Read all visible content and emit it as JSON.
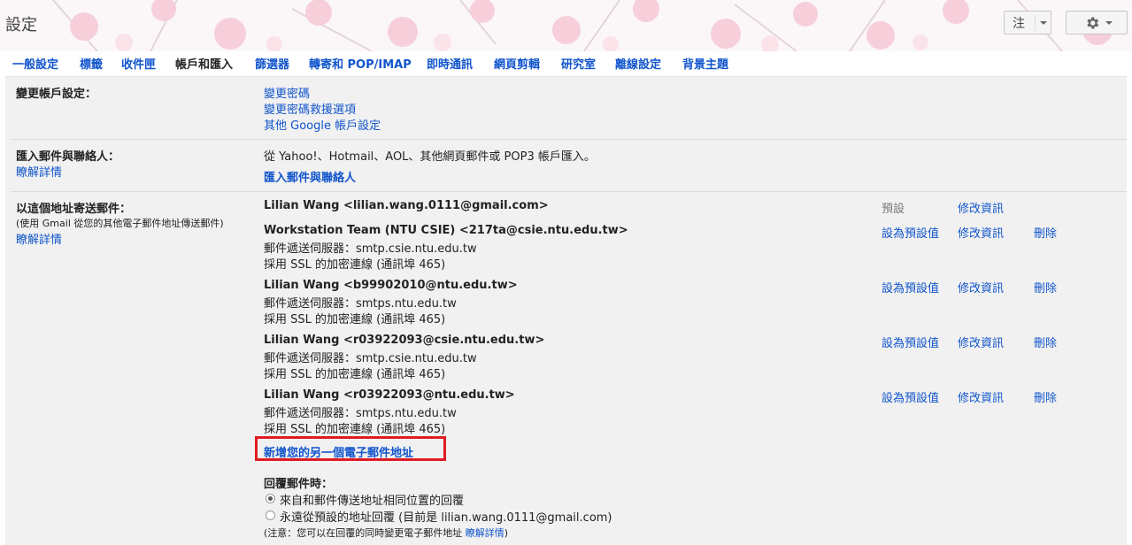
{
  "header": {
    "title": "設定",
    "input_tools_label": "注",
    "settings_icon": "gear-icon"
  },
  "tabs": [
    {
      "label": "一般設定",
      "active": false
    },
    {
      "label": "標籤",
      "active": false
    },
    {
      "label": "收件匣",
      "active": false
    },
    {
      "label": "帳戶和匯入",
      "active": true
    },
    {
      "label": "篩選器",
      "active": false
    },
    {
      "label": "轉寄和 POP/IMAP",
      "active": false
    },
    {
      "label": "即時通訊",
      "active": false
    },
    {
      "label": "網頁剪輯",
      "active": false
    },
    {
      "label": "研究室",
      "active": false
    },
    {
      "label": "離線設定",
      "active": false
    },
    {
      "label": "背景主題",
      "active": false
    }
  ],
  "change_account": {
    "label": "變更帳戶設定：",
    "links": [
      "變更密碼",
      "變更密碼救援選項",
      "其他 Google 帳戶設定"
    ]
  },
  "import": {
    "label": "匯入郵件與聯絡人：",
    "learn_more": "瞭解詳情",
    "description": "從 Yahoo!、Hotmail、AOL、其他網頁郵件或 POP3 帳戶匯入。",
    "action": "匯入郵件與聯絡人"
  },
  "send_as": {
    "label": "以這個地址寄送郵件：",
    "sublabel": "(使用 Gmail 從您的其他電子郵件地址傳送郵件)",
    "learn_more": "瞭解詳情",
    "addresses": [
      {
        "name": "Lilian Wang <lilian.wang.0111@gmail.com>",
        "server": "",
        "ssl": "",
        "status": "預設",
        "edit": "修改資訊",
        "delete": ""
      },
      {
        "name": "Workstation Team (NTU CSIE) <217ta@csie.ntu.edu.tw>",
        "server": "郵件遞送伺服器：smtp.csie.ntu.edu.tw",
        "ssl": "採用 SSL 的加密連線 (通訊埠 465)",
        "status": "設為預設值",
        "edit": "修改資訊",
        "delete": "刪除"
      },
      {
        "name": "Lilian Wang <b99902010@ntu.edu.tw>",
        "server": "郵件遞送伺服器：smtps.ntu.edu.tw",
        "ssl": "採用 SSL 的加密連線 (通訊埠 465)",
        "status": "設為預設值",
        "edit": "修改資訊",
        "delete": "刪除"
      },
      {
        "name": "Lilian Wang <r03922093@csie.ntu.edu.tw>",
        "server": "郵件遞送伺服器：smtp.csie.ntu.edu.tw",
        "ssl": "採用 SSL 的加密連線 (通訊埠 465)",
        "status": "設為預設值",
        "edit": "修改資訊",
        "delete": "刪除"
      },
      {
        "name": "Lilian Wang <r03922093@ntu.edu.tw>",
        "server": "郵件遞送伺服器：smtps.ntu.edu.tw",
        "ssl": "採用 SSL 的加密連線 (通訊埠 465)",
        "status": "設為預設值",
        "edit": "修改資訊",
        "delete": "刪除"
      }
    ],
    "add_address": "新增您的另一個電子郵件地址",
    "reply_label": "回覆郵件時：",
    "reply_options": [
      {
        "label": "來自和郵件傳送地址相同位置的回覆",
        "selected": true
      },
      {
        "label": "永遠從預設的地址回覆 (目前是 lilian.wang.0111@gmail.com)",
        "selected": false
      }
    ],
    "note": "(注意：您可以在回覆的同時變更電子郵件地址 ",
    "note_link": "瞭解詳情",
    "note_end": ")"
  }
}
